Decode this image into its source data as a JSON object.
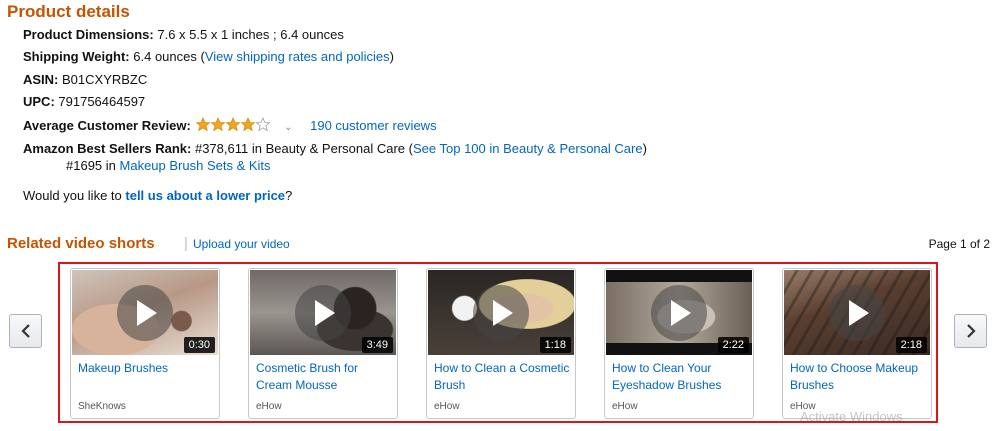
{
  "product_details": {
    "title": "Product details",
    "dimensions_label": "Product Dimensions:",
    "dimensions_value": "7.6 x 5.5 x 1 inches ; 6.4 ounces",
    "shipping_label": "Shipping Weight:",
    "shipping_value": "6.4 ounces (",
    "shipping_link": "View shipping rates and policies",
    "shipping_close": ")",
    "asin_label": "ASIN:",
    "asin_value": "B01CXYRBZC",
    "upc_label": "UPC:",
    "upc_value": "791756464597",
    "review_label": "Average Customer Review:",
    "review_rating": 4,
    "review_count_link": "190 customer reviews",
    "rank_label": "Amazon Best Sellers Rank:",
    "rank_value": "#378,611 in Beauty & Personal Care (",
    "rank_link": "See Top 100 in Beauty & Personal Care",
    "rank_close": ")",
    "sub_rank_value": "#1695 in",
    "sub_rank_link": "Makeup Brush Sets & Kits",
    "lower_price_prefix": "Would you like to",
    "lower_price_link": "tell us about a lower price",
    "lower_price_suffix": "?"
  },
  "video_shorts": {
    "title": "Related video shorts",
    "separator": "|",
    "upload_link": "Upload your video",
    "page_indicator": "Page 1 of 2",
    "videos": [
      {
        "title": "Makeup Brushes",
        "duration": "0:30",
        "source": "SheKnows"
      },
      {
        "title": "Cosmetic Brush for Cream Mousse",
        "duration": "3:49",
        "source": "eHow"
      },
      {
        "title": "How to Clean a Cosmetic Brush",
        "duration": "1:18",
        "source": "eHow"
      },
      {
        "title": "How to Clean Your Eyeshadow Brushes",
        "duration": "2:22",
        "source": "eHow"
      },
      {
        "title": "How to Choose Makeup Brushes",
        "duration": "2:18",
        "source": "eHow"
      }
    ]
  },
  "watermark": "Activate Windows",
  "colors": {
    "heading": "#c45500",
    "link": "#0066c0",
    "star": "#f4a41d",
    "carousel_border": "#d9161c"
  },
  "icons": {
    "prev": "chevron-left-icon",
    "next": "chevron-right-icon",
    "play": "play-icon",
    "stars": "star-icon",
    "dropdown": "chevron-down-icon"
  }
}
